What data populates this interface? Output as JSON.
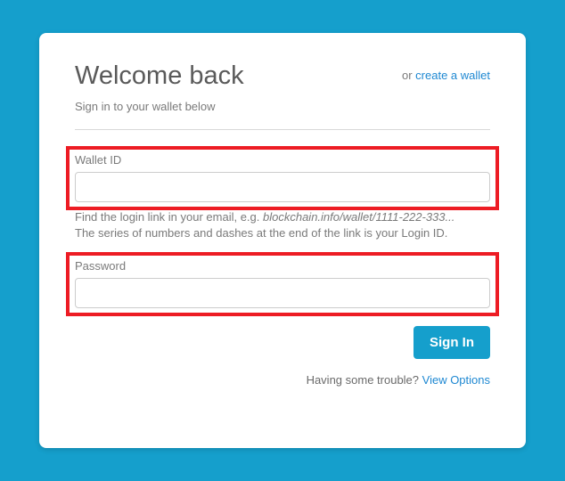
{
  "header": {
    "title": "Welcome back",
    "or_text": "or ",
    "create_link": "create a wallet",
    "subtitle": "Sign in to your wallet below"
  },
  "fields": {
    "wallet_id": {
      "label": "Wallet ID",
      "value": "",
      "hint_prefix": "Find the login link in your email, e.g. ",
      "hint_example": "blockchain.info/wallet/1111-222-333...",
      "hint_line2": "The series of numbers and dashes at the end of the link is your Login ID."
    },
    "password": {
      "label": "Password",
      "value": ""
    }
  },
  "actions": {
    "signin_label": "Sign In"
  },
  "footer": {
    "trouble_text": "Having some trouble? ",
    "options_link": "View Options"
  }
}
